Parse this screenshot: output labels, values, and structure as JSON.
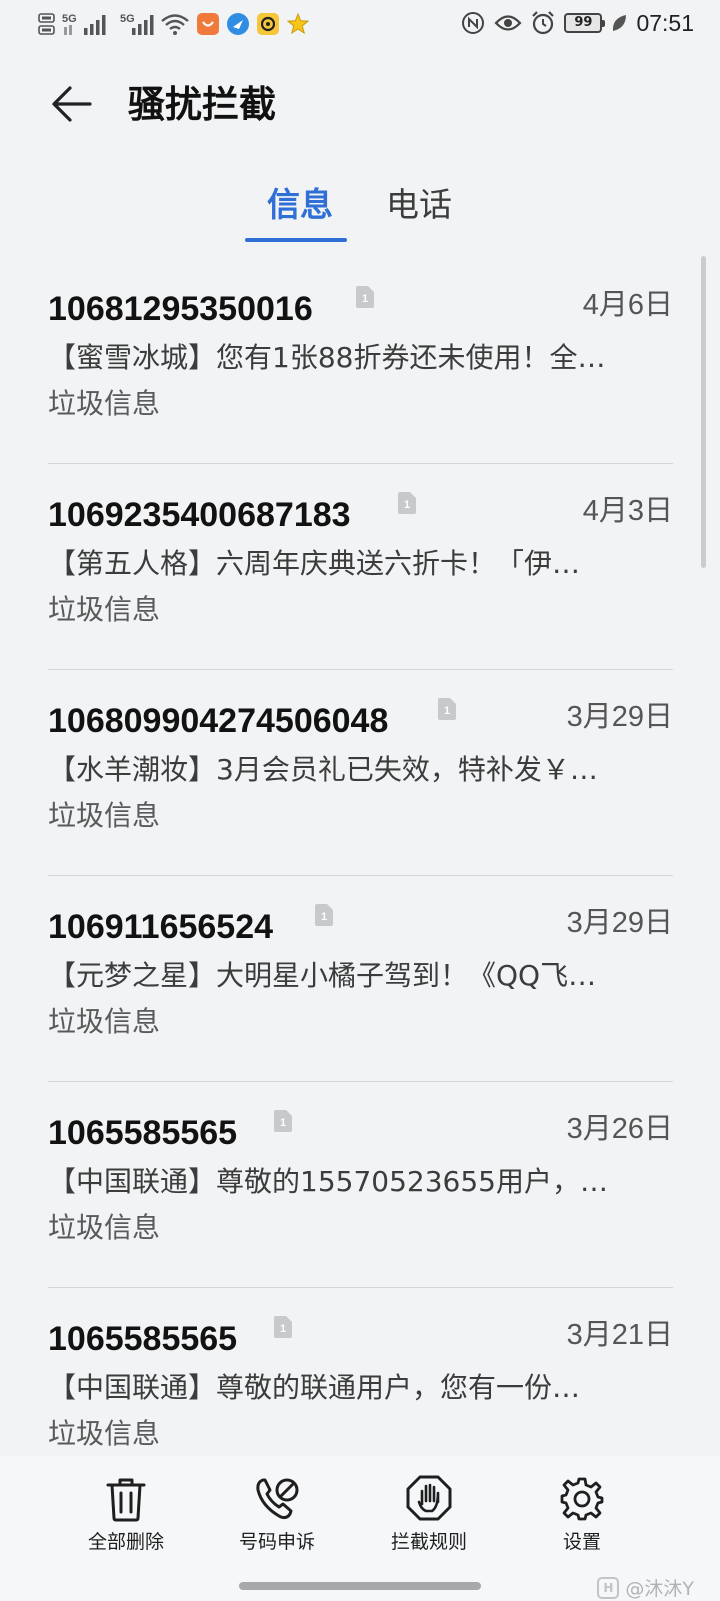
{
  "status_bar": {
    "signal1_label": "5G",
    "signal2_label": "5G",
    "battery_level": "99",
    "time": "07:51"
  },
  "app_bar": {
    "title": "骚扰拦截"
  },
  "tabs": [
    {
      "label": "信息",
      "active": true
    },
    {
      "label": "电话",
      "active": false
    }
  ],
  "messages": [
    {
      "sender": "10681295350016",
      "date": "4月6日",
      "preview": "【蜜雪冰城】您有1张88折券还未使用！全…",
      "tag": "垃圾信息",
      "sim": "1"
    },
    {
      "sender": "1069235400687183",
      "date": "4月3日",
      "preview": "【第五人格】六周年庆典送六折卡！「伊…",
      "tag": "垃圾信息",
      "sim": "1"
    },
    {
      "sender": "106809904274506048",
      "date": "3月29日",
      "preview": "【水羊潮妆】3月会员礼已失效，特补发￥…",
      "tag": "垃圾信息",
      "sim": "1"
    },
    {
      "sender": "106911656524",
      "date": "3月29日",
      "preview": "【元梦之星】大明星小橘子驾到！《QQ飞…",
      "tag": "垃圾信息",
      "sim": "1"
    },
    {
      "sender": "1065585565",
      "date": "3月26日",
      "preview": "【中国联通】尊敬的15570523655用户，…",
      "tag": "垃圾信息",
      "sim": "1"
    },
    {
      "sender": "1065585565",
      "date": "3月21日",
      "preview": "【中国联通】尊敬的联通用户，您有一份…",
      "tag": "垃圾信息",
      "sim": "1"
    }
  ],
  "bottom_actions": [
    {
      "label": "全部删除",
      "icon": "trash-icon"
    },
    {
      "label": "号码申诉",
      "icon": "phone-block-icon"
    },
    {
      "label": "拦截规则",
      "icon": "hand-stop-icon"
    },
    {
      "label": "设置",
      "icon": "gear-icon"
    }
  ],
  "watermark": {
    "box_text": "H",
    "user": "@沐沐Y"
  },
  "colors": {
    "accent": "#2f6fd6",
    "background": "#f1f3f5"
  }
}
